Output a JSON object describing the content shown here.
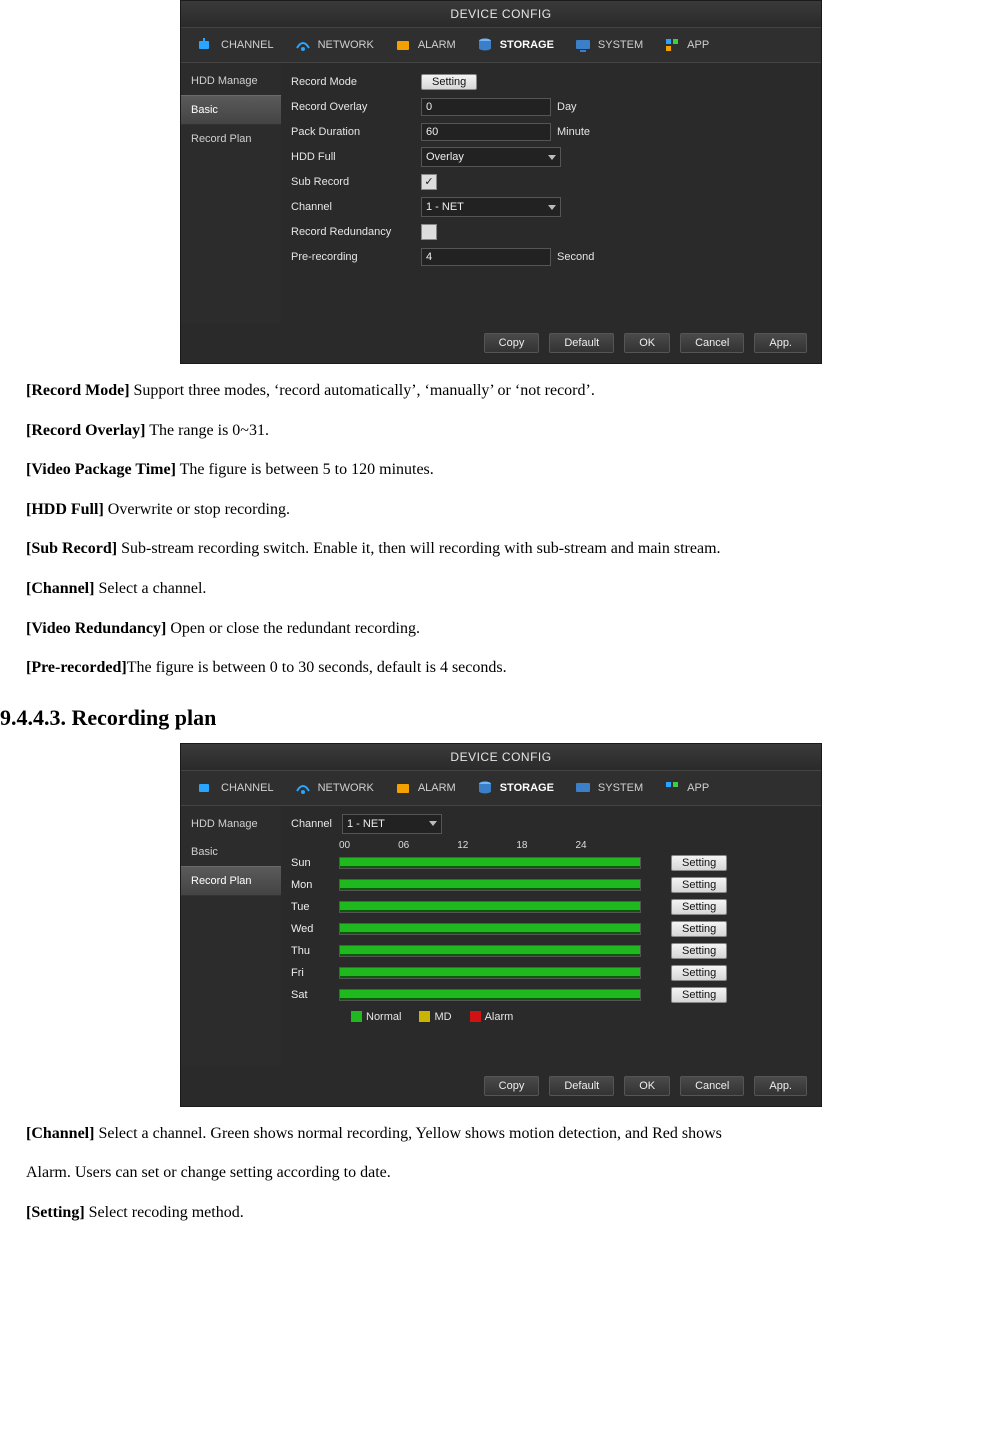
{
  "window": {
    "title": "DEVICE CONFIG",
    "tabs": [
      {
        "label": "CHANNEL"
      },
      {
        "label": "NETWORK"
      },
      {
        "label": "ALARM"
      },
      {
        "label": "STORAGE"
      },
      {
        "label": "SYSTEM"
      },
      {
        "label": "APP"
      }
    ],
    "sidebar": [
      {
        "label": "HDD Manage"
      },
      {
        "label": "Basic"
      },
      {
        "label": "Record Plan"
      }
    ],
    "footer": {
      "copy": "Copy",
      "default": "Default",
      "ok": "OK",
      "cancel": "Cancel",
      "app": "App."
    }
  },
  "basic": {
    "fields": {
      "record_mode": {
        "label": "Record Mode",
        "button": "Setting"
      },
      "record_overlay": {
        "label": "Record Overlay",
        "value": "0",
        "unit": "Day"
      },
      "pack_duration": {
        "label": "Pack Duration",
        "value": "60",
        "unit": "Minute"
      },
      "hdd_full": {
        "label": "HDD Full",
        "value": "Overlay"
      },
      "sub_record": {
        "label": "Sub Record",
        "checked": true
      },
      "channel": {
        "label": "Channel",
        "value": "1 - NET"
      },
      "record_redundancy": {
        "label": "Record Redundancy",
        "checked": false
      },
      "pre_recording": {
        "label": "Pre-recording",
        "value": "4",
        "unit": "Second"
      }
    }
  },
  "plan": {
    "channel_label": "Channel",
    "channel_value": "1 - NET",
    "hours": [
      "00",
      "06",
      "12",
      "18",
      "24"
    ],
    "days": [
      "Sun",
      "Mon",
      "Tue",
      "Wed",
      "Thu",
      "Fri",
      "Sat"
    ],
    "setting_btn": "Setting",
    "legend": {
      "normal": "Normal",
      "md": "MD",
      "alarm": "Alarm"
    }
  },
  "doc": {
    "p1_label": "[Record Mode]",
    "p1_text": " Support three modes, ‘record automatically’, ‘manually’ or ‘not record’.",
    "p2_label": "[Record Overlay]",
    "p2_text": " The range is 0~31.",
    "p3_label": "[Video Package Time]",
    "p3_text": " The figure is between 5 to 120 minutes.",
    "p4_label": "[HDD Full]",
    "p4_text": " Overwrite or stop recording.",
    "p5_label": "[Sub Record]",
    "p5_text": " Sub-stream recording switch. Enable it, then will recording with sub-stream and main stream.",
    "p6_label": "[Channel]",
    "p6_text": " Select a channel.",
    "p7_label": "[Video Redundancy]",
    "p7_text": " Open or close the redundant recording.",
    "p8_label": "[Pre-recorded]",
    "p8_text": "The figure is between 0 to 30 seconds, default is 4 seconds.",
    "section_heading": "9.4.4.3. Recording plan",
    "p9_label": "[Channel]",
    "p9_text": " Select a channel. Green shows normal recording, Yellow shows motion detection, and Red shows",
    "p9b_text": "Alarm. Users can set or change setting according to date.",
    "p10_label": "[Setting]",
    "p10_text": " Select recoding method."
  }
}
